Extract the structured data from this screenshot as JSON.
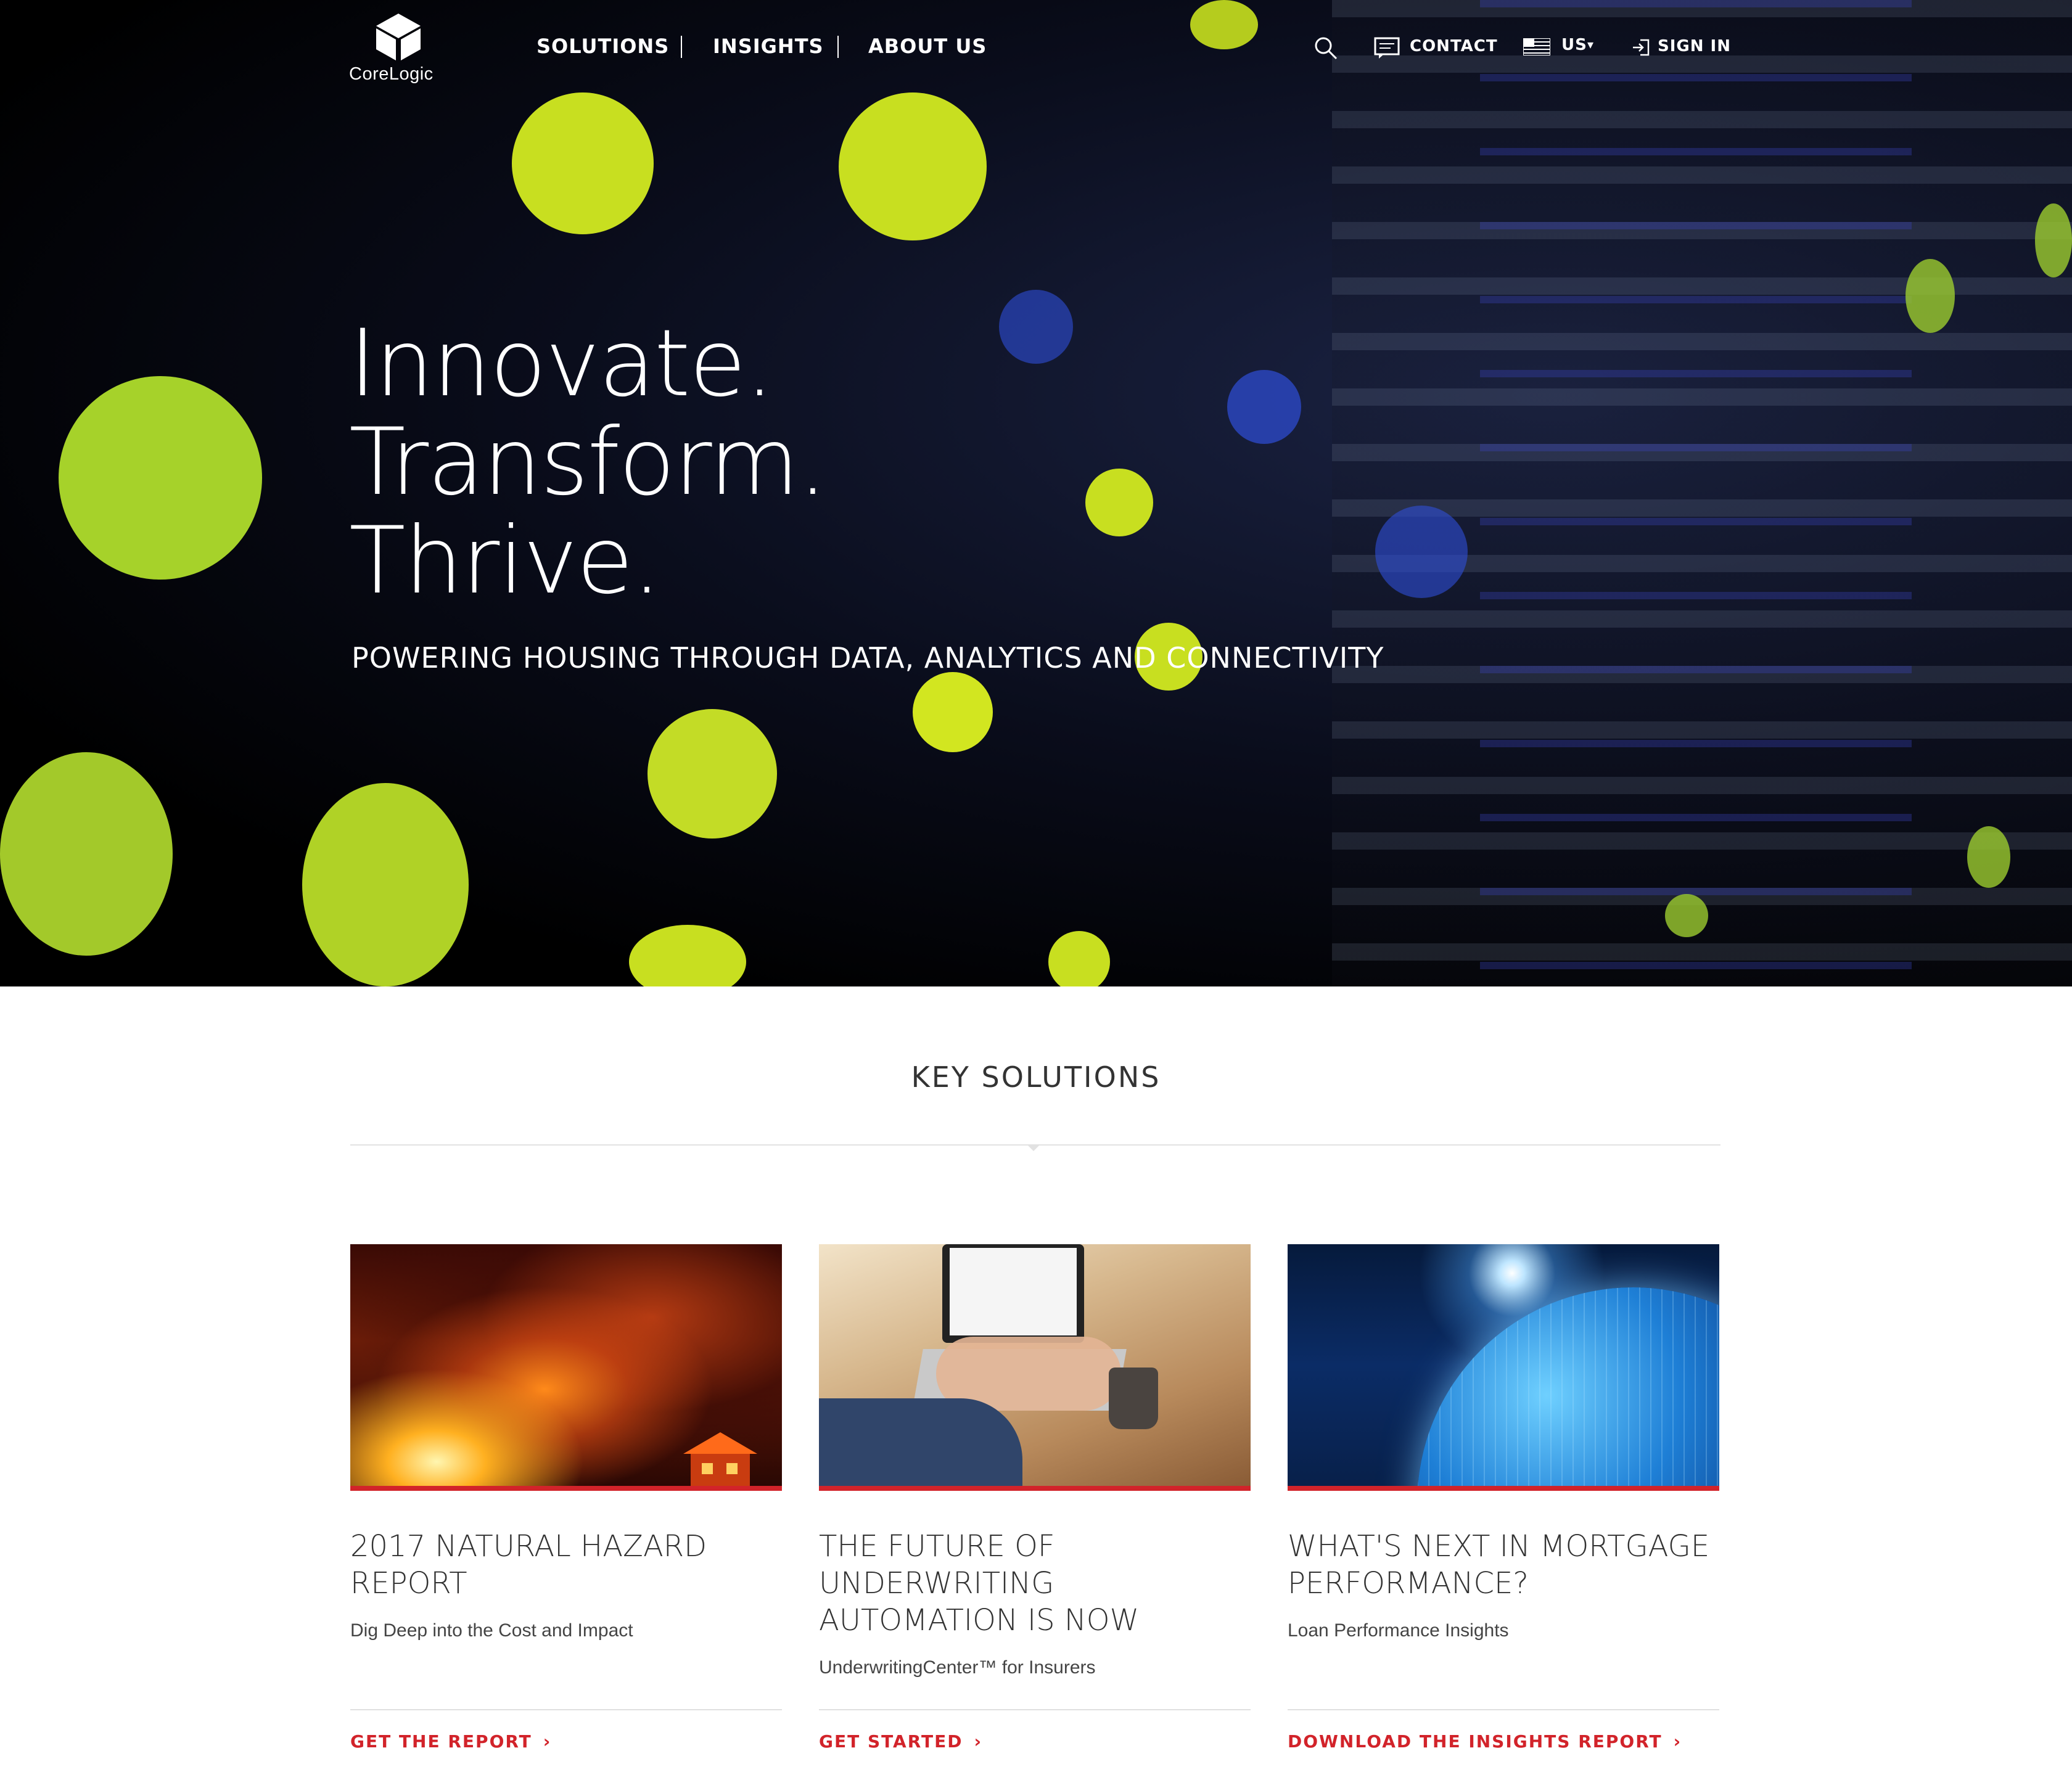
{
  "brand": {
    "name": "CoreLogic"
  },
  "nav": {
    "items": [
      "SOLUTIONS",
      "INSIGHTS",
      "ABOUT US"
    ],
    "contact": "CONTACT",
    "region": "US",
    "sign_in": "SIGN IN"
  },
  "hero": {
    "lines": [
      "Innovate.",
      "Transform.",
      "Thrive."
    ],
    "tagline": "POWERING HOUSING THROUGH DATA, ANALYTICS AND CONNECTIVITY"
  },
  "key_solutions": {
    "title": "KEY SOLUTIONS",
    "cards": [
      {
        "title": "2017 NATURAL HAZARD REPORT",
        "subtitle": "Dig Deep into the Cost and Impact",
        "link": "GET THE REPORT"
      },
      {
        "title": "THE FUTURE OF UNDERWRITING AUTOMATION IS NOW",
        "subtitle": "UnderwritingCenter™ for Insurers",
        "link": "GET STARTED"
      },
      {
        "title": "WHAT'S NEXT IN MORTGAGE PERFORMANCE?",
        "subtitle": "Loan Performance Insights",
        "link": "DOWNLOAD THE INSIGHTS REPORT"
      }
    ]
  },
  "colors": {
    "accent": "#d2232a",
    "bokeh_green": "#c8df20",
    "hero_dark": "#0a0d1c"
  },
  "icons": [
    "logo-cube-icon",
    "search-icon",
    "contact-icon",
    "us-flag-icon",
    "caret-down-icon",
    "sign-in-icon",
    "chevron-right-icon"
  ]
}
